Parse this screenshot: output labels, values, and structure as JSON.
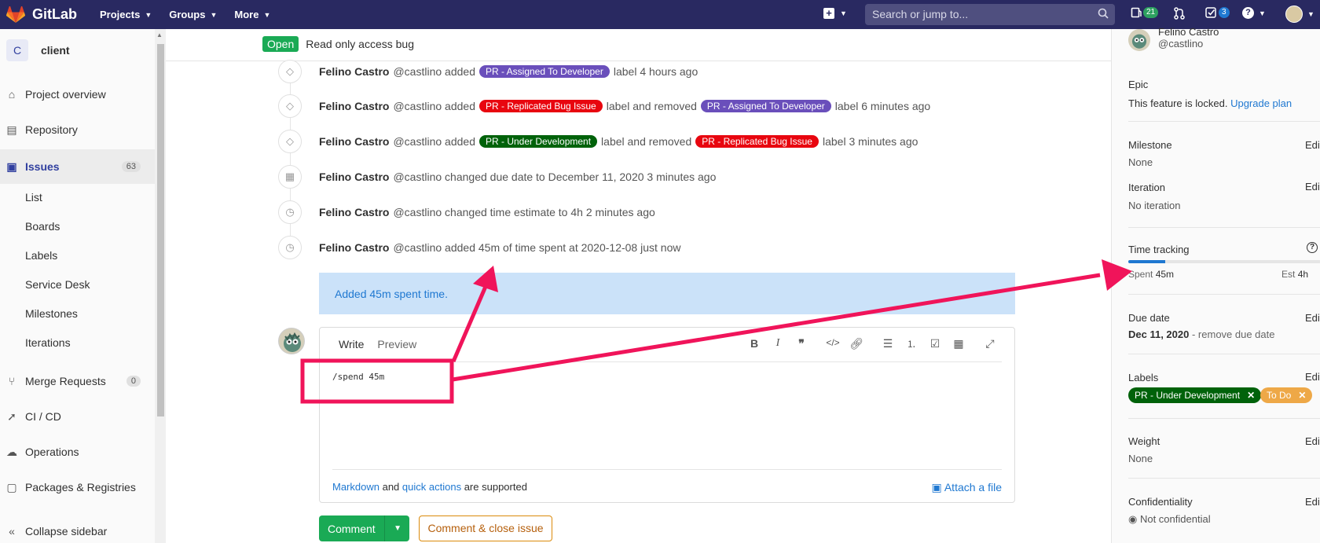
{
  "topnav": {
    "brand": "GitLab",
    "projects": "Projects",
    "groups": "Groups",
    "more": "More",
    "search_placeholder": "Search or jump to...",
    "issues_count": "21",
    "todos_count": "3"
  },
  "sidebar": {
    "project_initial": "C",
    "project_name": "client",
    "items": [
      {
        "label": "Project overview",
        "icon": "home-icon"
      },
      {
        "label": "Repository",
        "icon": "doc-icon"
      },
      {
        "label": "Issues",
        "icon": "issues-icon",
        "count": "63"
      },
      {
        "label": "Merge Requests",
        "icon": "merge-icon",
        "count": "0"
      },
      {
        "label": "CI / CD",
        "icon": "rocket-icon"
      },
      {
        "label": "Operations",
        "icon": "cloud-icon"
      },
      {
        "label": "Packages & Registries",
        "icon": "package-icon"
      }
    ],
    "sub_items": [
      "List",
      "Boards",
      "Labels",
      "Service Desk",
      "Milestones",
      "Iterations"
    ],
    "collapse": "Collapse sidebar"
  },
  "issue": {
    "status": "Open",
    "title": "Read only access bug"
  },
  "timeline": [
    {
      "name": "Felino Castro",
      "user": "@castlino",
      "icon": "tag-icon"
    },
    {
      "name": "Felino Castro",
      "user": "@castlino",
      "icon": "tag-icon"
    },
    {
      "name": "Felino Castro",
      "user": "@castlino",
      "icon": "tag-icon"
    },
    {
      "name": "Felino Castro",
      "user": "@castlino",
      "icon": "calendar-icon"
    },
    {
      "name": "Felino Castro",
      "user": "@castlino",
      "icon": "timer-icon"
    },
    {
      "name": "Felino Castro",
      "user": "@castlino",
      "icon": "timer-icon"
    }
  ],
  "timeline_text": {
    "added": "added",
    "label_4h": "label 4 hours ago",
    "label_removed": "label and removed",
    "label_6m": "label 6 minutes ago",
    "label_3m": "label 3 minutes ago",
    "due": "changed due date to December 11, 2020 3 minutes ago",
    "estimate": "changed time estimate to 4h 2 minutes ago",
    "spent": "added 45m of time spent at 2020-12-08 just now"
  },
  "labels": {
    "assigned": {
      "text": "PR - Assigned To Developer",
      "color": "#6a4fbb"
    },
    "replicated": {
      "text": "PR - Replicated Bug Issue",
      "color": "#e8060f"
    },
    "underdev": {
      "text": "PR - Under Development",
      "color": "#00620a"
    },
    "todo": {
      "text": "To Do",
      "color": "#eea847"
    }
  },
  "system_note": "Added 45m spent time.",
  "editor": {
    "tab_write": "Write",
    "tab_preview": "Preview",
    "content": "/spend 45m",
    "markdown": "Markdown",
    "and": "and",
    "quick_actions": "quick actions",
    "supported": "are supported",
    "attach": "Attach a file"
  },
  "buttons": {
    "comment": "Comment",
    "close": "Comment & close issue"
  },
  "right_sidebar": {
    "assignee_name": "Felino Castro",
    "assignee_user": "@castlino",
    "epic_title": "Epic",
    "epic_locked": "This feature is locked.",
    "epic_upgrade": "Upgrade plan",
    "milestone_title": "Milestone",
    "milestone_value": "None",
    "iteration_title": "Iteration",
    "iteration_value": "No iteration",
    "time_title": "Time tracking",
    "spent_label": "Spent",
    "spent_value": "45m",
    "est_label": "Est",
    "est_value": "4h",
    "spent_fraction": 0.19,
    "due_title": "Due date",
    "due_value": "Dec 11, 2020",
    "due_remove": "- remove due date",
    "labels_title": "Labels",
    "weight_title": "Weight",
    "weight_value": "None",
    "conf_title": "Confidentiality",
    "conf_value": "Not confidential",
    "edit": "Edit"
  },
  "colors": {
    "nav": "#292961",
    "accent": "#1f78d1",
    "annotation": "#f0145a"
  }
}
